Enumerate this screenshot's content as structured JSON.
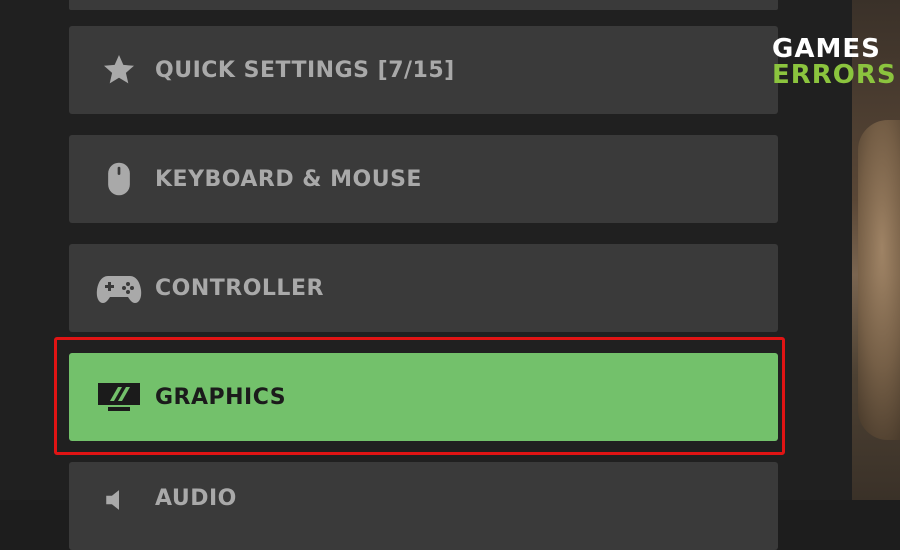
{
  "menu": {
    "items": [
      {
        "id": "quick-settings",
        "label": "QUICK SETTINGS [7/15]",
        "icon": "star-icon",
        "selected": false
      },
      {
        "id": "keyboard-mouse",
        "label": "KEYBOARD & MOUSE",
        "icon": "mouse-icon",
        "selected": false
      },
      {
        "id": "controller",
        "label": "CONTROLLER",
        "icon": "gamepad-icon",
        "selected": false
      },
      {
        "id": "graphics",
        "label": "GRAPHICS",
        "icon": "monitor-icon",
        "selected": true
      },
      {
        "id": "audio",
        "label": "AUDIO",
        "icon": "speaker-icon",
        "selected": false
      }
    ]
  },
  "watermark": {
    "line1": "GAMES",
    "line2": "ERRORS"
  },
  "colors": {
    "item_bg": "#3a3a3a",
    "selected_bg": "#73c16b",
    "highlight": "#e01414",
    "watermark_green": "#8bc43e"
  }
}
